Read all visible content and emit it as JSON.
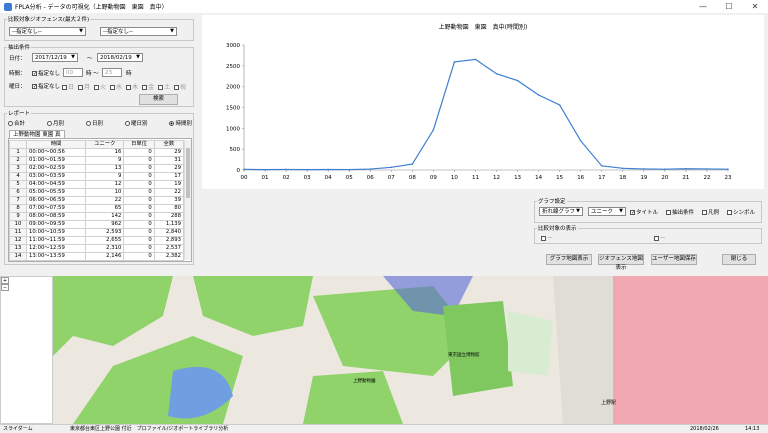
{
  "window": {
    "title": "FPLA分析 - データの可視化（上野動物園　東園　真中）",
    "min": "—",
    "max": "☐",
    "close": "✕"
  },
  "compare": {
    "label": "比較対象ジオフェンス(最大２件)",
    "combo1": "--指定なし--",
    "combo2": "--指定なし--"
  },
  "extract": {
    "label": "抽出条件",
    "date_label": "日付：",
    "date_from": "2017/12/19",
    "tilde": "〜",
    "date_to": "2018/02/19",
    "time_label": "時間：",
    "time_unspec": "指定なし",
    "time_from": "00",
    "time_from_suffix": "時 〜",
    "time_to": "23",
    "time_to_suffix": "時",
    "dow_label": "曜日：",
    "dow_unspec": "指定なし",
    "days": [
      "日",
      "月",
      "火",
      "水",
      "木",
      "金",
      "土",
      "祝"
    ],
    "search": "検索"
  },
  "report": {
    "label": "レポート",
    "options": [
      "合計",
      "月別",
      "日別",
      "曜日別",
      "時間別"
    ],
    "selected": 4,
    "tab": "上野動物園 東園 真",
    "columns": [
      "時間",
      "ユニーク",
      "日単位",
      "全数"
    ],
    "rows": [
      [
        "1",
        "00:00〜00:56",
        "16",
        "0",
        "29"
      ],
      [
        "2",
        "01:00〜01:59",
        "9",
        "0",
        "31"
      ],
      [
        "3",
        "02:00〜02:59",
        "13",
        "0",
        "29"
      ],
      [
        "4",
        "03:00〜03:59",
        "9",
        "0",
        "17"
      ],
      [
        "5",
        "04:00〜04:59",
        "12",
        "0",
        "19"
      ],
      [
        "6",
        "05:00〜05:59",
        "10",
        "0",
        "22"
      ],
      [
        "7",
        "06:00〜06:59",
        "22",
        "0",
        "39"
      ],
      [
        "8",
        "07:00〜07:59",
        "65",
        "0",
        "80"
      ],
      [
        "9",
        "08:00〜08:59",
        "142",
        "0",
        "288"
      ],
      [
        "10",
        "09:00〜09:59",
        "962",
        "0",
        "1,139"
      ],
      [
        "11",
        "10:00〜10:59",
        "2,593",
        "0",
        "2,840"
      ],
      [
        "12",
        "11:00〜11:59",
        "2,655",
        "0",
        "2,893"
      ],
      [
        "13",
        "12:00〜12:59",
        "2,310",
        "0",
        "2,537"
      ],
      [
        "14",
        "13:00〜13:59",
        "2,146",
        "0",
        "2,382"
      ]
    ]
  },
  "chart_data": {
    "type": "line",
    "title": "上野動物園　東園　真中(時間別)",
    "categories": [
      "00",
      "01",
      "02",
      "03",
      "04",
      "05",
      "06",
      "07",
      "08",
      "09",
      "10",
      "11",
      "12",
      "13",
      "14",
      "15",
      "16",
      "17",
      "18",
      "19",
      "20",
      "21",
      "22",
      "23"
    ],
    "values": [
      16,
      9,
      13,
      9,
      12,
      10,
      22,
      65,
      142,
      962,
      2593,
      2655,
      2310,
      2146,
      1800,
      1560,
      700,
      100,
      40,
      25,
      20,
      30,
      25,
      20
    ],
    "ylim": [
      0,
      3000
    ],
    "yticks": [
      "0",
      "500",
      "1000",
      "1500",
      "2000",
      "2500",
      "3000"
    ],
    "color": "#3d7fd1",
    "grid": false
  },
  "graph": {
    "label": "グラフ設定",
    "type": "折れ線グラフ",
    "measure": "ユニーク",
    "opts": [
      "タイトル",
      "抽出条件",
      "凡例",
      "シンボル"
    ],
    "checked": [
      true,
      false,
      false,
      false
    ]
  },
  "compare_disp": {
    "label": "比較対象の表示",
    "items": [
      "ー",
      "ー"
    ]
  },
  "buttons": {
    "graph_map": "グラフ地図表示",
    "geofence_map": "ジオフェンス地図表示",
    "user": "ユーザー地図保存",
    "close": "閉じる"
  },
  "map": {
    "station_label": "上野駅",
    "label2": "東京国立博物館",
    "label3": "上野動物園"
  },
  "status": {
    "left": "スライダーム",
    "center": "東京都台東区上野公園 付近　プロファイル/ジオポートライブラリ分析",
    "date": "2018/02/26",
    "time": "14:13"
  }
}
